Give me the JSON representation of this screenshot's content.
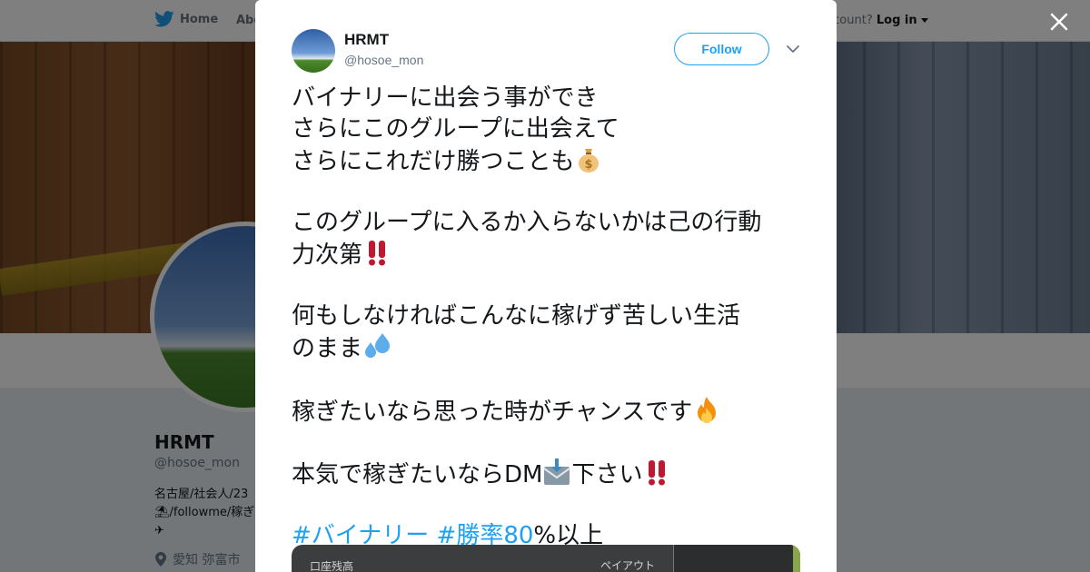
{
  "nav": {
    "home_label": "Home",
    "about_label": "Abo",
    "account_prompt": "ccount?",
    "login_label": "Log in"
  },
  "profile": {
    "name": "HRMT",
    "handle": "@hosoe_mon",
    "bio_line1": "名古屋/社会人/23",
    "bio_line2": "/followme/稼ぎ",
    "location": "愛知 弥富市"
  },
  "tweet": {
    "author_name": "HRMT",
    "author_handle": "@hosoe_mon",
    "follow_label": "Follow",
    "lines": {
      "l1": "バイナリーに出会う事ができ",
      "l2": "さらにこのグループに出会えて",
      "l3": "さらにこれだけ勝つことも",
      "l4": "このグループに入るか入らないかは己の行動",
      "l5": "力次第",
      "l6": "何もしなければこんなに稼げず苦しい生活",
      "l7": "のまま",
      "l8": "稼ぎたいなら思った時がチャンスです",
      "l9a": "本気で稼ぎたいならDM",
      "l9b": "下さい"
    },
    "hashtag1": "#バイナリー",
    "hashtag2": "#勝率80",
    "hashtag_suffix": "%以上",
    "media": {
      "label_left": "口座残高",
      "label_right": "ペイアウト"
    }
  },
  "colors": {
    "accent": "#1da1f2",
    "text": "#14171a",
    "muted": "#657786"
  },
  "icons": [
    "twitter-bird-icon",
    "caret-down-icon",
    "close-icon",
    "location-pin-icon",
    "chevron-down-icon",
    "money-bag-emoji",
    "double-exclamation-emoji",
    "sweat-droplets-emoji",
    "fire-emoji",
    "inbox-tray-emoji"
  ]
}
